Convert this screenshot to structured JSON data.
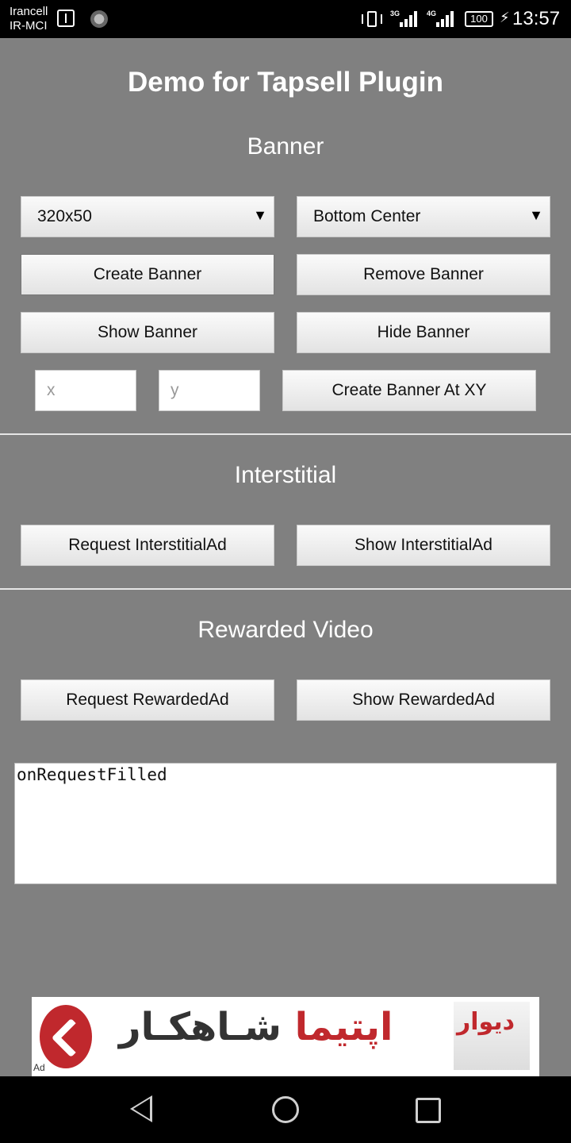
{
  "status_bar": {
    "carrier_1": "Irancell",
    "carrier_2": "IR-MCI",
    "network_1": "3G",
    "network_2": "4G",
    "battery": "100",
    "time": "13:57"
  },
  "header": {
    "title": "Demo for Tapsell Plugin"
  },
  "banner": {
    "heading": "Banner",
    "size_select": "320x50",
    "position_select": "Bottom Center",
    "create_label": "Create Banner",
    "remove_label": "Remove Banner",
    "show_label": "Show Banner",
    "hide_label": "Hide Banner",
    "x_placeholder": "x",
    "y_placeholder": "y",
    "create_xy_label": "Create Banner At XY"
  },
  "interstitial": {
    "heading": "Interstitial",
    "request_label": "Request InterstitialAd",
    "show_label": "Show InterstitialAd"
  },
  "rewarded": {
    "heading": "Rewarded Video",
    "request_label": "Request RewardedAd",
    "show_label": "Show RewardedAd"
  },
  "log": {
    "text": "onRequestFilled"
  },
  "ad": {
    "text_red": "اپتیما",
    "text_dark": " شـاهکـار",
    "logo_text": "دیوار",
    "tag": "Ad"
  },
  "colors": {
    "background": "#808080",
    "ad_red": "#c0282d"
  }
}
